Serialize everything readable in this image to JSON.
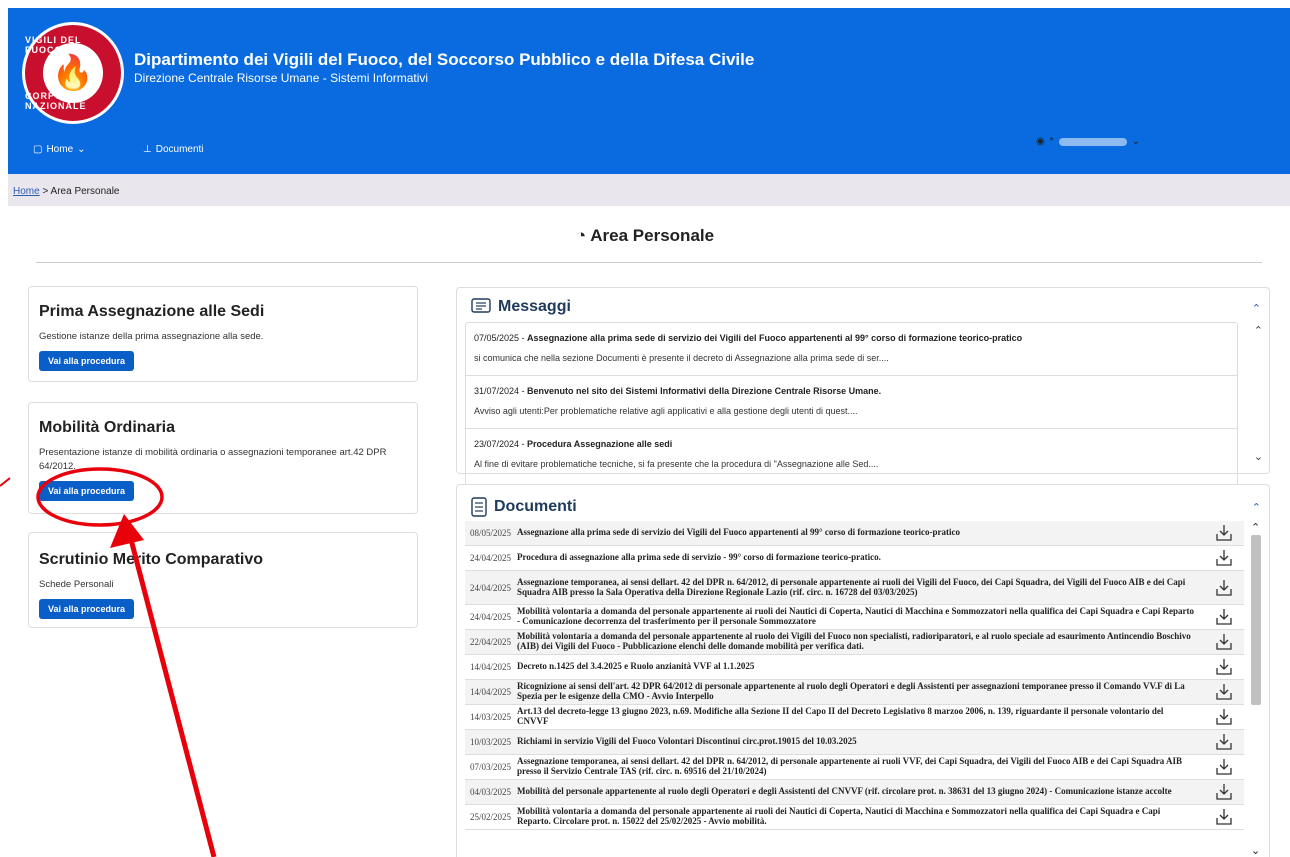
{
  "header": {
    "logo_top": "VIGILI DEL FUOCO",
    "logo_bottom": "CORPO NAZIONALE",
    "title": "Dipartimento dei Vigili del Fuoco, del Soccorso Pubblico e della Difesa Civile",
    "subtitle": "Direzione Centrale Risorse Umane - Sistemi Informativi",
    "nav": [
      {
        "label": "Home",
        "icon": "home-icon",
        "dropdown": true
      },
      {
        "label": "Documenti",
        "icon": "pin-icon",
        "dropdown": false
      }
    ],
    "user_prefix": "*"
  },
  "breadcrumb": {
    "home": "Home",
    "sep": ">",
    "current": "Area Personale"
  },
  "page_title": "Area Personale",
  "cards": [
    {
      "title": "Prima Assegnazione alle Sedi",
      "desc": "Gestione istanze della prima assegnazione alla sede.",
      "button": "Vai alla procedura"
    },
    {
      "title": "Mobilità Ordinaria",
      "desc": "Presentazione istanze di mobilità ordinaria o assegnazioni temporanee art.42 DPR 64/2012.",
      "button": "Vai alla procedura"
    },
    {
      "title": "Scrutinio Merito Comparativo",
      "desc": "Schede Personali",
      "button": "Vai alla procedura"
    }
  ],
  "messages": {
    "title": "Messaggi",
    "items": [
      {
        "date": "07/05/2025",
        "sep": " - ",
        "title": "Assegnazione alla prima sede di servizio dei Vigili del Fuoco appartenenti al 99° corso di formazione teorico-pratico",
        "preview": "si comunica che nella sezione Documenti è presente il decreto di Assegnazione alla prima sede di ser...."
      },
      {
        "date": "31/07/2024",
        "sep": " - ",
        "title": "Benvenuto nel sito dei Sistemi Informativi della Direzione Centrale Risorse Umane.",
        "preview": "Avviso agli utenti:Per problematiche relative agli applicativi e alla gestione degli utenti di quest...."
      },
      {
        "date": "23/07/2024",
        "sep": " - ",
        "title": "Procedura Assegnazione alle sedi",
        "preview": "Al fine di evitare problematiche tecniche, si fa presente che la procedura di \"Assegnazione alle Sed...."
      }
    ]
  },
  "documents": {
    "title": "Documenti",
    "items": [
      {
        "date": "08/05/2025",
        "title": "Assegnazione alla prima sede di servizio dei Vigili del Fuoco appartenenti al 99° corso di formazione teorico-pratico"
      },
      {
        "date": "24/04/2025",
        "title": "Procedura di assegnazione alla prima sede di servizio - 99° corso di formazione teorico-pratico."
      },
      {
        "date": "24/04/2025",
        "title": "Assegnazione temporanea, ai sensi dellart. 42 del DPR n. 64/2012, di personale appartenente ai ruoli dei Vigili del Fuoco, dei Capi Squadra, dei Vigili del Fuoco AIB e dei Capi Squadra AIB presso la Sala Operativa della Direzione Regionale Lazio (rif. circ. n. 16728 del 03/03/2025)"
      },
      {
        "date": "24/04/2025",
        "title": "Mobilità volontaria a domanda del personale appartenente ai ruoli dei Nautici di Coperta, Nautici di Macchina e Sommozzatori nella qualifica dei Capi Squadra e Capi Reparto - Comunicazione decorrenza del trasferimento per il personale Sommozzatore"
      },
      {
        "date": "22/04/2025",
        "title": "Mobilità volontaria a domanda del personale appartenente al ruolo dei Vigili del Fuoco non specialisti, radioriparatori, e al ruolo speciale ad esaurimento Antincendio Boschivo (AIB) dei Vigili del Fuoco - Pubblicazione elenchi delle domande mobilità per verifica dati."
      },
      {
        "date": "14/04/2025",
        "title": "Decreto n.1425 del 3.4.2025 e Ruolo anzianità VVF al 1.1.2025"
      },
      {
        "date": "14/04/2025",
        "title": "Ricognizione ai sensi dell'art. 42 DPR 64/2012 di personale appartenente al ruolo degli Operatori e degli Assistenti per assegnazioni temporanee presso il Comando VV.F di La Spezia per le esigenze della CMO - Avvio Interpello"
      },
      {
        "date": "14/03/2025",
        "title": "Art.13 del decreto-legge 13 giugno 2023, n.69. Modifiche alla Sezione II del Capo II del Decreto Legislativo 8 marzoo 2006, n. 139, riguardante il personale volontario del CNVVF"
      },
      {
        "date": "10/03/2025",
        "title": "Richiami in servizio Vigili del Fuoco Volontari Discontinui circ.prot.19015 del 10.03.2025"
      },
      {
        "date": "07/03/2025",
        "title": "Assegnazione temporanea, ai sensi dellart. 42 del DPR n. 64/2012, di personale appartenente ai ruoli VVF, dei Capi Squadra, dei Vigili del Fuoco AIB e dei Capi Squadra AIB presso il Servizio Centrale TAS (rif. circ. n. 69516 del 21/10/2024)"
      },
      {
        "date": "04/03/2025",
        "title": "Mobilità del personale appartenente al ruolo degli Operatori e degli Assistenti del CNVVF (rif. circolare prot. n. 38631 del 13 giugno 2024) - Comunicazione istanze accolte"
      },
      {
        "date": "25/02/2025",
        "title": "Mobilità volontaria a domanda del personale appartenente ai ruoli dei Nautici di Coperta, Nautici di Macchina e Sommozzatori nella qualifica dei Capi Squadra e Capi Reparto. Circolare prot. n. 15022 del 25/02/2025 - Avvio mobilità."
      }
    ]
  },
  "colors": {
    "header": "#0a6be0",
    "button": "#0a5ec7",
    "annotation": "#e8000b",
    "breadcrumb_bg": "#e9e6ee"
  }
}
